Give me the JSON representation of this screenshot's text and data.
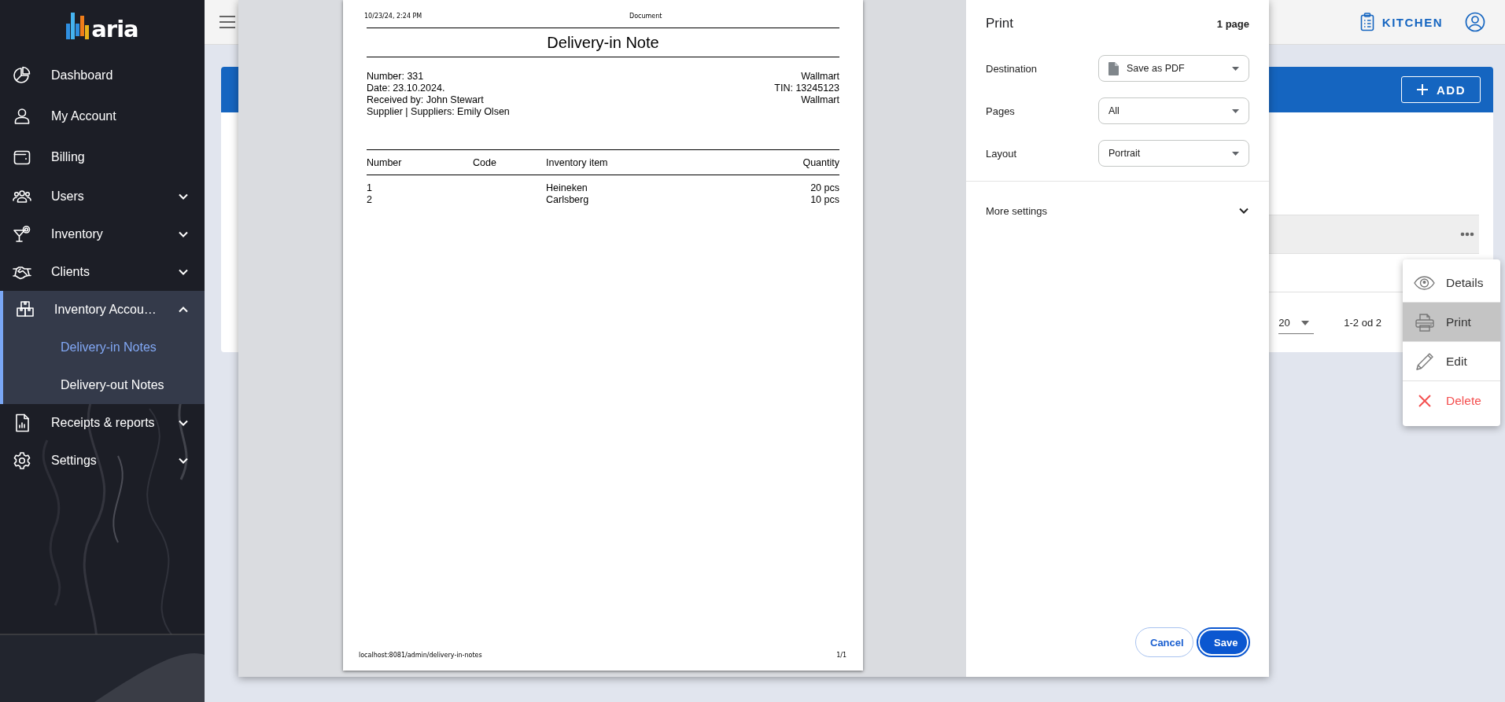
{
  "sidebar": {
    "logo": "aria",
    "items": [
      {
        "label": "Dashboard",
        "kind": "link"
      },
      {
        "label": "My Account",
        "kind": "link"
      },
      {
        "label": "Billing",
        "kind": "link"
      },
      {
        "label": "Users",
        "kind": "group",
        "expanded": false
      },
      {
        "label": "Inventory",
        "kind": "group",
        "expanded": false
      },
      {
        "label": "Clients",
        "kind": "group",
        "expanded": false
      },
      {
        "label": "Inventory Accou…",
        "kind": "group",
        "expanded": true,
        "children": [
          {
            "label": "Delivery-in Notes",
            "selected": true
          },
          {
            "label": "Delivery-out Notes",
            "selected": false
          }
        ]
      },
      {
        "label": "Receipts & reports",
        "kind": "group",
        "expanded": false
      },
      {
        "label": "Settings",
        "kind": "group",
        "expanded": false
      }
    ]
  },
  "topbar": {
    "location": "KITCHEN"
  },
  "card": {
    "add_button": "ADD",
    "rows": [
      {
        "highlighted": true
      }
    ],
    "pagination": {
      "page_size": "20",
      "range": "1-2 od 2"
    }
  },
  "print_dialog": {
    "preview": {
      "header_date": "10/23/24, 2:24 PM",
      "header_title": "Document",
      "title": "Delivery-in Note",
      "info_left": [
        "Number: 331",
        "Date: 23.10.2024.",
        "Received by: John Stewart",
        "Supplier | Suppliers: Emily Olsen"
      ],
      "info_right": [
        "Wallmart",
        "TIN: 13245123",
        "Wallmart"
      ],
      "columns": [
        "Number",
        "Code",
        "Inventory item",
        "Quantity"
      ],
      "rows": [
        {
          "number": "1",
          "item": "Heineken",
          "quantity": "20 pcs"
        },
        {
          "number": "2",
          "item": "Carlsberg",
          "quantity": "10 pcs"
        }
      ],
      "footer_url": "localhost:8081/admin/delivery-in-notes",
      "footer_page": "1/1"
    },
    "settings": {
      "title": "Print",
      "page_count": "1 page",
      "fields": [
        {
          "label": "Destination",
          "value": "Save as PDF",
          "kind": "file"
        },
        {
          "label": "Pages",
          "value": "All",
          "kind": "plain"
        },
        {
          "label": "Layout",
          "value": "Portrait",
          "kind": "plain"
        }
      ],
      "more_settings": "More settings",
      "more_expanded": false,
      "buttons": [
        {
          "label": "Cancel",
          "kind": "secondary"
        },
        {
          "label": "Save",
          "kind": "primary"
        }
      ]
    }
  },
  "context_menu": {
    "items": [
      {
        "label": "Details",
        "kind": "details",
        "selected": false
      },
      {
        "label": "Print",
        "kind": "print",
        "selected": true
      },
      {
        "label": "Edit",
        "kind": "edit",
        "selected": false
      },
      {
        "label": "Delete",
        "kind": "delete",
        "selected": false
      }
    ]
  }
}
